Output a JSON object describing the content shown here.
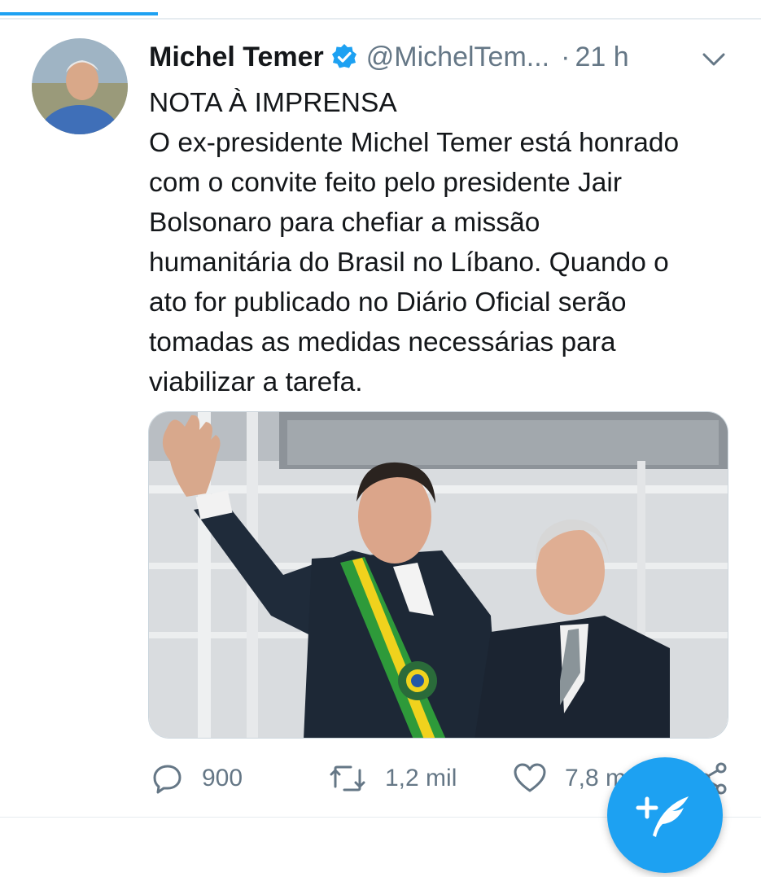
{
  "header": {
    "display_name": "Michel Temer",
    "handle": "@MichelTem...",
    "separator": "·",
    "time": "21 h"
  },
  "tweet": {
    "title": "NOTA À IMPRENSA",
    "lines": [
      "O ex-presidente Michel Temer está honrado",
      "com o convite feito pelo presidente Jair",
      "Bolsonaro para chefiar a missão",
      "humanitária do Brasil no Líbano. Quando o",
      "ato for publicado no Diário Oficial serão",
      "tomadas as medidas necessárias para",
      "viabilizar a tarefa."
    ]
  },
  "actions": {
    "replies": "900",
    "retweets": "1,2 mil",
    "likes": "7,8 m"
  },
  "icons": {
    "verified": "verified-badge-icon",
    "caret": "chevron-down-icon",
    "reply": "reply-icon",
    "retweet": "retweet-icon",
    "like": "heart-icon",
    "share": "share-icon",
    "compose": "compose-tweet-icon"
  },
  "colors": {
    "accent": "#1da1f2",
    "text": "#14171a",
    "secondary": "#657786"
  }
}
